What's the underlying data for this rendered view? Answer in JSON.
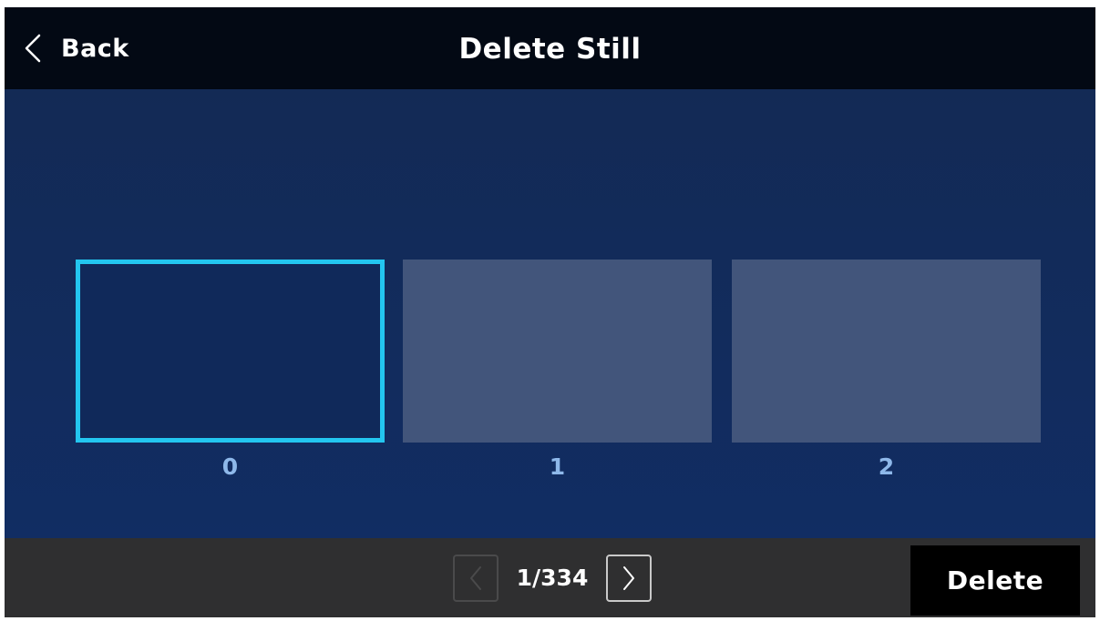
{
  "header": {
    "back_label": "Back",
    "title": "Delete Still",
    "back_icon": "chevron-left-icon"
  },
  "stills": [
    {
      "label": "0",
      "selected": true
    },
    {
      "label": "1",
      "selected": false
    },
    {
      "label": "2",
      "selected": false
    }
  ],
  "footer": {
    "page_indicator": "1/334",
    "prev_icon": "chevron-left-icon",
    "next_icon": "chevron-right-icon",
    "prev_enabled": false,
    "next_enabled": true,
    "delete_label": "Delete"
  },
  "colors": {
    "header_bg": "#030914",
    "content_bg": "#112d63",
    "selection_border": "#23c6f0",
    "thumbnail_bg": "#42557b",
    "label_color": "#8eb8ea",
    "footer_bg": "#2f2f30",
    "delete_bg": "#000000"
  }
}
